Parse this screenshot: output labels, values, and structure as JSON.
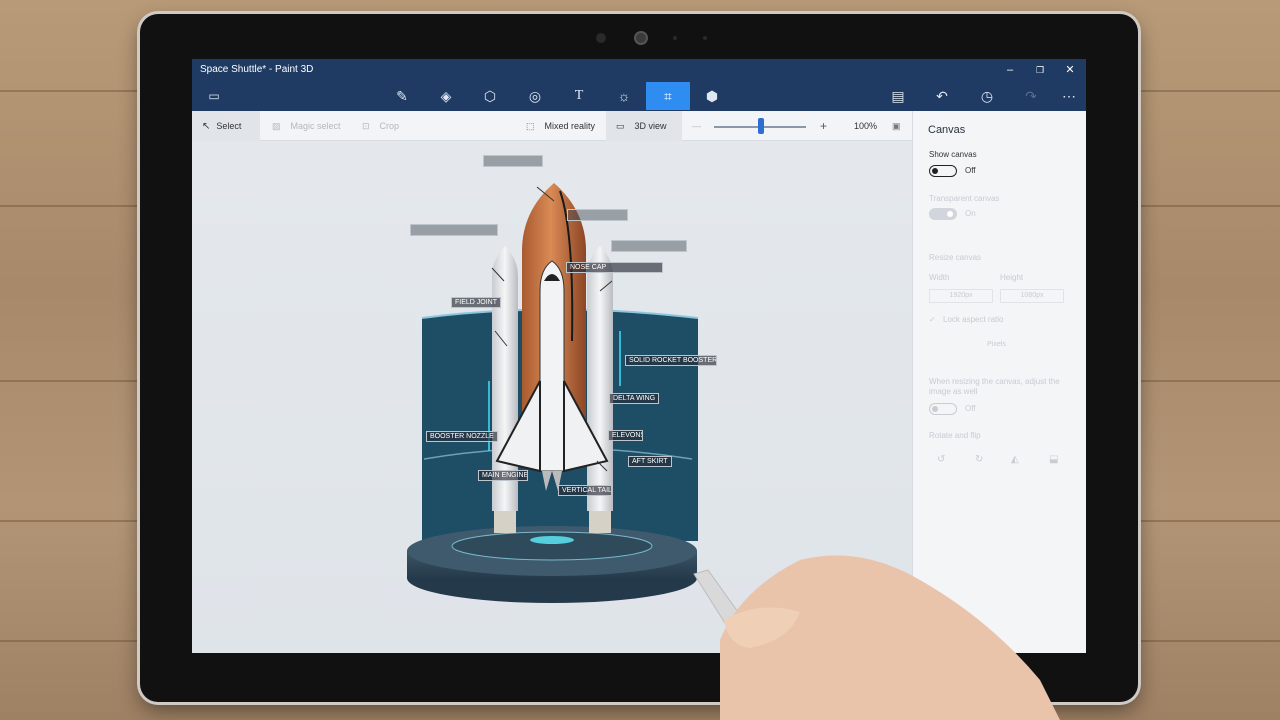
{
  "window": {
    "title": "Space Shuttle* - Paint 3D",
    "minimize_glyph": "–",
    "maximize_glyph": "❐",
    "close_glyph": "✕"
  },
  "toolbar": {
    "menu_icon": "menu-folder-icon",
    "tools": [
      {
        "name": "brushes",
        "icon": "brush-icon",
        "glyph": "✎"
      },
      {
        "name": "2d-shapes",
        "icon": "2d-shapes-icon",
        "glyph": "◈"
      },
      {
        "name": "3d-shapes",
        "icon": "3d-shapes-icon",
        "glyph": "⬡"
      },
      {
        "name": "stickers",
        "icon": "sticker-icon",
        "glyph": "◎"
      },
      {
        "name": "text",
        "icon": "text-icon",
        "glyph": "T"
      },
      {
        "name": "effects",
        "icon": "effects-icon",
        "glyph": "☼"
      },
      {
        "name": "canvas",
        "icon": "canvas-crop-icon",
        "glyph": "⌗"
      },
      {
        "name": "3d-library",
        "icon": "3d-library-icon",
        "glyph": "⬢"
      }
    ],
    "right_tools": [
      {
        "name": "paste",
        "icon": "paste-icon",
        "glyph": "▤"
      },
      {
        "name": "undo",
        "icon": "undo-icon",
        "glyph": "↶"
      },
      {
        "name": "history",
        "icon": "history-icon",
        "glyph": "◷"
      },
      {
        "name": "redo",
        "icon": "redo-icon",
        "glyph": "↷"
      },
      {
        "name": "more",
        "icon": "more-icon",
        "glyph": "⋯"
      }
    ]
  },
  "subtoolbar": {
    "select_label": "Select",
    "magic_select_label": "Magic select",
    "crop_label": "Crop",
    "mixed_reality_label": "Mixed reality",
    "view_3d_label": "3D view",
    "zoom_minus": "—",
    "zoom_plus": "+",
    "zoom_level": "100%",
    "zoom_value": 0.48
  },
  "panel": {
    "title": "Canvas",
    "show_canvas_label": "Show canvas",
    "show_canvas_state": "Off",
    "transparent_canvas_label": "Transparent canvas",
    "transparent_canvas_state": "On",
    "resize_label": "Resize canvas",
    "width_label": "Width",
    "height_label": "Height",
    "width_value": "1920px",
    "height_value": "1080px",
    "lock_aspect_label": "Lock aspect ratio",
    "units_value": "Pixels",
    "resize_image_label": "When resizing the canvas, adjust the image as well",
    "resize_image_state": "Off",
    "rotate_flip_label": "Rotate and flip"
  },
  "labels": {
    "field_joint": "FIELD JOINT",
    "solid_rocket_booster": "SOLID ROCKET BOOSTER",
    "delta_wing": "DELTA WING",
    "booster_nozzle": "BOOSTER NOZZLE",
    "elevons": "ELEVONS",
    "aft_skirt": "AFT SKIRT",
    "main_engine": "MAIN ENGINE",
    "vertical_tail": "VERTICAL TAIL",
    "nose_cap": "NOSE CAP"
  },
  "colors": {
    "titlebar": "#1f3b63",
    "accent": "#2f8cf0",
    "panel_bg": "#f3f5f7",
    "external_tank": "#c8703f",
    "display_backdrop": "#1e4d66"
  }
}
